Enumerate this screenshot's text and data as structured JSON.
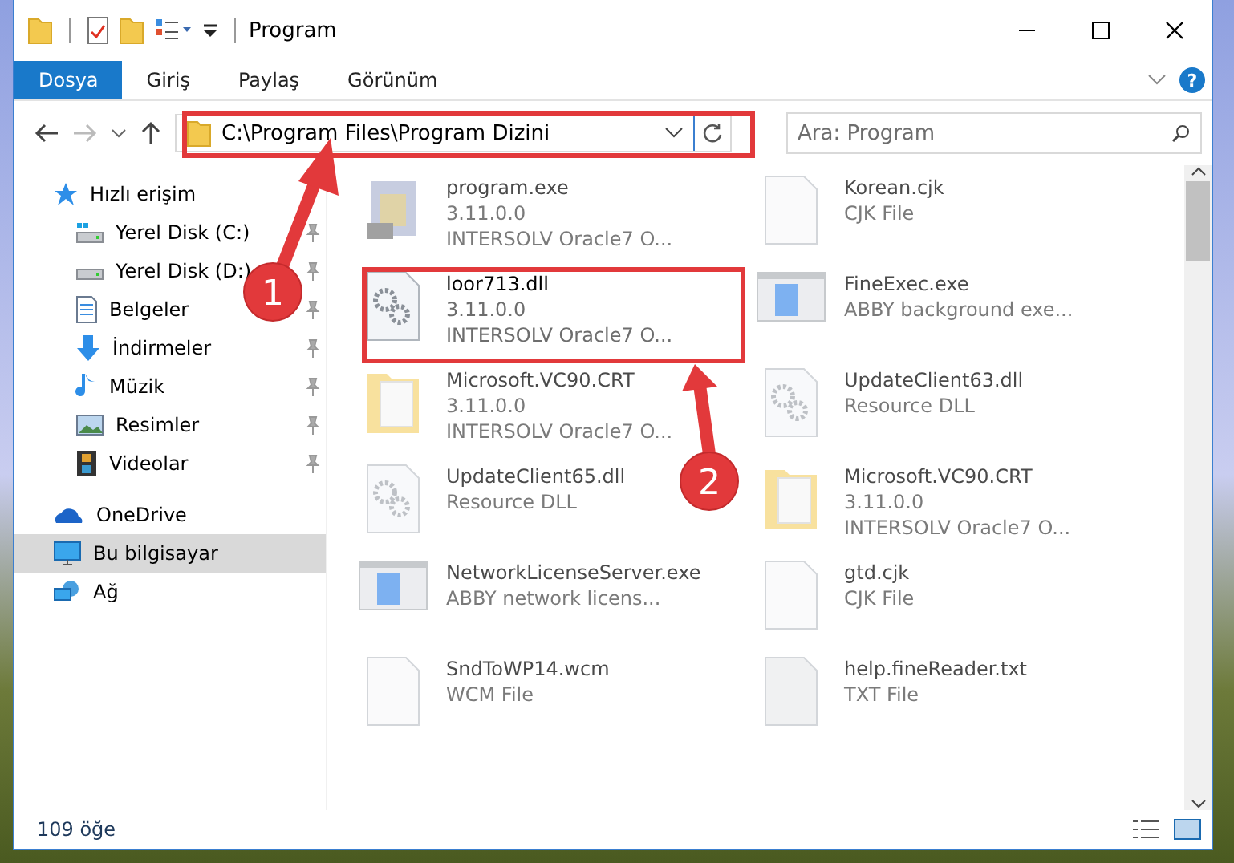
{
  "window": {
    "title": "Program"
  },
  "ribbon": {
    "tabs": [
      {
        "label": "Dosya",
        "selected": true
      },
      {
        "label": "Giriş",
        "selected": false
      },
      {
        "label": "Paylaş",
        "selected": false
      },
      {
        "label": "Görünüm",
        "selected": false
      }
    ],
    "help": "?"
  },
  "address_bar": {
    "path": "C:\\Program Files\\Program Dizini",
    "search_placeholder": "Ara: Program"
  },
  "sidebar": {
    "items": [
      {
        "label": "Hızlı erişim",
        "kind": "star",
        "selected": false,
        "children": [
          {
            "label": "Yerel Disk (C:)",
            "kind": "drive-c",
            "pinned": true,
            "selected": false
          },
          {
            "label": "Yerel Disk (D:)",
            "kind": "drive",
            "pinned": true,
            "selected": false
          },
          {
            "label": "Belgeler",
            "kind": "docs",
            "pinned": true,
            "selected": false
          },
          {
            "label": "İndirmeler",
            "kind": "download",
            "pinned": true,
            "selected": false
          },
          {
            "label": "Müzik",
            "kind": "music",
            "pinned": true,
            "selected": false
          },
          {
            "label": "Resimler",
            "kind": "pictures",
            "pinned": true,
            "selected": false
          },
          {
            "label": "Videolar",
            "kind": "videos",
            "pinned": true,
            "selected": false
          }
        ]
      },
      {
        "label": "OneDrive",
        "kind": "cloud",
        "selected": false
      },
      {
        "label": "Bu bilgisayar",
        "kind": "pc",
        "selected": true
      },
      {
        "label": "Ağ",
        "kind": "network",
        "selected": false
      }
    ]
  },
  "files": {
    "columns": [
      [
        {
          "name": "program.exe",
          "details": [
            "3.11.0.0",
            "INTERSOLV Oracle7 O..."
          ],
          "kind": "app",
          "dimmed": true
        },
        {
          "name": "loor713.dll",
          "details": [
            "3.11.0.0",
            "INTERSOLV Oracle7 O..."
          ],
          "kind": "dll",
          "dimmed": false
        },
        {
          "name": "Microsoft.VC90.CRT",
          "details": [
            "3.11.0.0",
            "INTERSOLV Oracle7 O..."
          ],
          "kind": "folder",
          "dimmed": true
        },
        {
          "name": "UpdateClient65.dll",
          "details": [
            "Resource DLL"
          ],
          "kind": "dll",
          "dimmed": true
        },
        {
          "name": "NetworkLicenseServer.exe",
          "details": [
            "ABBY network licens..."
          ],
          "kind": "window",
          "dimmed": true
        },
        {
          "name": "SndToWP14.wcm",
          "details": [
            "WCM File"
          ],
          "kind": "blank",
          "dimmed": true
        }
      ],
      [
        {
          "name": "Korean.cjk",
          "details": [
            "CJK File"
          ],
          "kind": "blank",
          "dimmed": true
        },
        {
          "name": "FineExec.exe",
          "details": [
            "ABBY background exe..."
          ],
          "kind": "window",
          "dimmed": true
        },
        {
          "name": "UpdateClient63.dll",
          "details": [
            "Resource DLL"
          ],
          "kind": "dll",
          "dimmed": true
        },
        {
          "name": "Microsoft.VC90.CRT",
          "details": [
            "3.11.0.0",
            "INTERSOLV Oracle7 O..."
          ],
          "kind": "folder",
          "dimmed": true
        },
        {
          "name": "gtd.cjk",
          "details": [
            "CJK File"
          ],
          "kind": "blank",
          "dimmed": true
        },
        {
          "name": "help.fineReader.txt",
          "details": [
            "TXT File"
          ],
          "kind": "text",
          "dimmed": true
        }
      ]
    ]
  },
  "status_bar": {
    "count": "109 öğe"
  },
  "callouts": [
    {
      "label": "1"
    },
    {
      "label": "2"
    }
  ]
}
